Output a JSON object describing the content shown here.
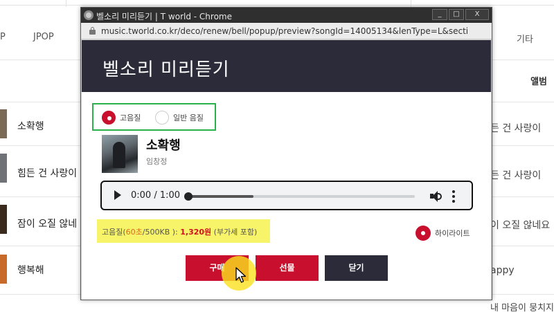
{
  "background": {
    "genres": [
      "P",
      "JPOP",
      "기타"
    ],
    "album_header": "앨범",
    "songs": [
      "소확행",
      "힘든 건 사랑이",
      "잠이 오질 않네",
      "행복해"
    ],
    "albums": [
      "든 건 사랑이",
      "든 건 사랑이",
      "이 오질 않네요",
      "appy",
      "내 마음이 뭉치지"
    ]
  },
  "window": {
    "title": "벨소리 미리듣기 | T world - Chrome",
    "controls": {
      "minimize": "_",
      "maximize": "□",
      "close": "X"
    },
    "url": "music.tworld.co.kr/deco/renew/bell/popup/preview?songId=14005134&lenType=L&secti"
  },
  "popup": {
    "title": "벨소리 미리듣기",
    "quality": {
      "options": [
        "고음질",
        "일반 음질"
      ],
      "selected": "고음질"
    },
    "song": {
      "title": "소확행",
      "artist": "임창정"
    },
    "player": {
      "time": "0:00 / 1:00",
      "progress": 0
    },
    "price": {
      "prefix": "고음질(",
      "seconds": "60초",
      "size": "/500KB ): ",
      "amount": "1,320원",
      "suffix": " (부가세 포함)"
    },
    "highlight_label": "하이라이트",
    "buttons": {
      "buy": "구매",
      "gift": "선물",
      "close": "닫기"
    }
  },
  "colors": {
    "accent_red": "#c8102e",
    "header_dark": "#2b2b3a",
    "quality_border": "#2ab24a",
    "price_highlight": "#f7f46a",
    "cursor_halo": "#fae11e"
  },
  "icons": [
    "play-icon",
    "volume-icon",
    "more-vert-icon",
    "lock-icon",
    "cursor-icon",
    "radio-icon"
  ]
}
